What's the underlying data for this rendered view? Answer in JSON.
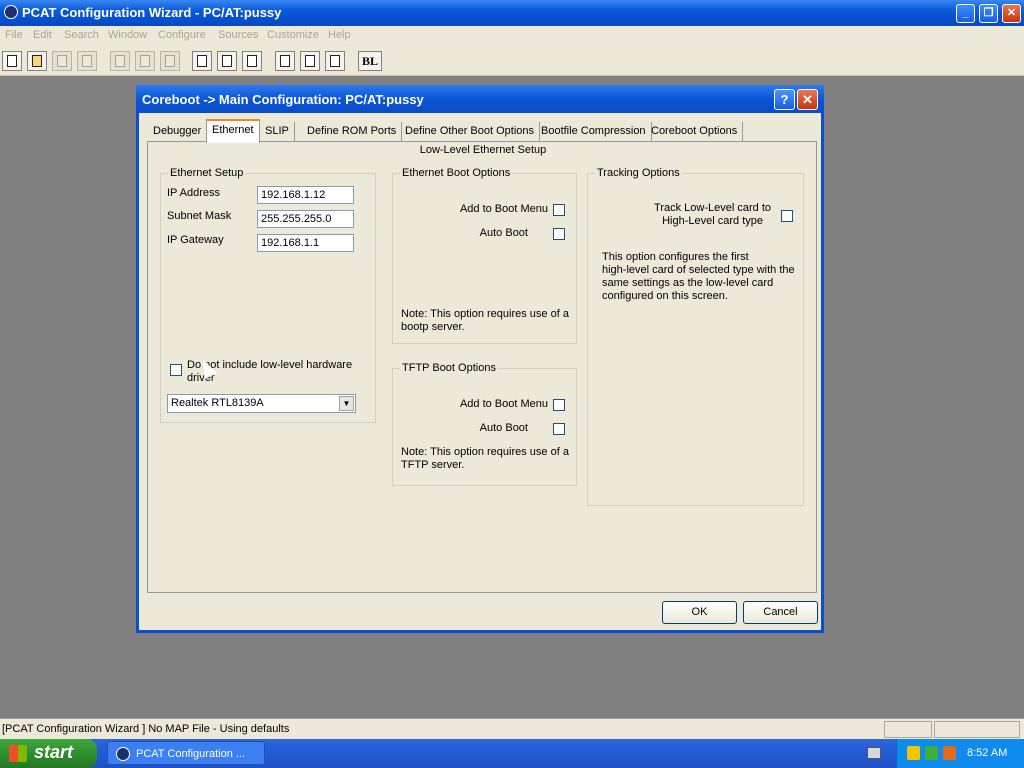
{
  "window": {
    "title": "PCAT Configuration Wizard  - PC/AT:pussy"
  },
  "menu": [
    "File",
    "Edit",
    "Search",
    "Window",
    "Configure",
    "Sources",
    "Customize",
    "Help"
  ],
  "toolbar": {
    "bl_label": "BL"
  },
  "dialog": {
    "title": "Coreboot  -> Main Configuration: PC/AT:pussy",
    "help_label": "?",
    "close_label": "✕",
    "tabs": [
      "Debugger",
      "Ethernet",
      "SLIP",
      "Define ROM Ports",
      "Define Other Boot Options",
      "Bootfile Compression",
      "Coreboot Options"
    ],
    "active_tab": "Ethernet",
    "panel_caption": "Low-Level Ethernet Setup",
    "ethernet_setup": {
      "legend": "Ethernet Setup",
      "ip_label": "IP Address",
      "ip_value": "192.168.1.12",
      "mask_label": "Subnet Mask",
      "mask_value": "255.255.255.0",
      "gateway_label": "IP Gateway",
      "gateway_value": "192.168.1.1",
      "exclude_driver_label_1": "Do not include low-level hardware",
      "exclude_driver_label_2": "driver",
      "exclude_driver_checked": false,
      "nic_selected": "Realtek RTL8139A"
    },
    "ethernet_boot": {
      "legend": "Ethernet Boot Options",
      "add_menu_label": "Add to Boot Menu",
      "auto_boot_label": "Auto Boot",
      "note_1": "Note: This option requires use of a",
      "note_2": "bootp server."
    },
    "tftp_boot": {
      "legend": "TFTP Boot Options",
      "add_menu_label": "Add to Boot Menu",
      "auto_boot_label": "Auto Boot",
      "note_1": "Note: This option requires use of a",
      "note_2": "TFTP server."
    },
    "tracking": {
      "legend": "Tracking Options",
      "track_label_1": "Track Low-Level card to",
      "track_label_2": "High-Level card type",
      "desc_1": "This option configures the first",
      "desc_2": "high-level card of selected type with the",
      "desc_3": "same settings as the low-level card",
      "desc_4": "configured on this screen."
    },
    "ok_label": "OK",
    "cancel_label": "Cancel"
  },
  "statusbar": {
    "message": "[PCAT Configuration Wizard ] No MAP File - Using defaults"
  },
  "taskbar": {
    "start_label": "start",
    "task_label": "PCAT Configuration ...",
    "clock": "8:52 AM"
  }
}
